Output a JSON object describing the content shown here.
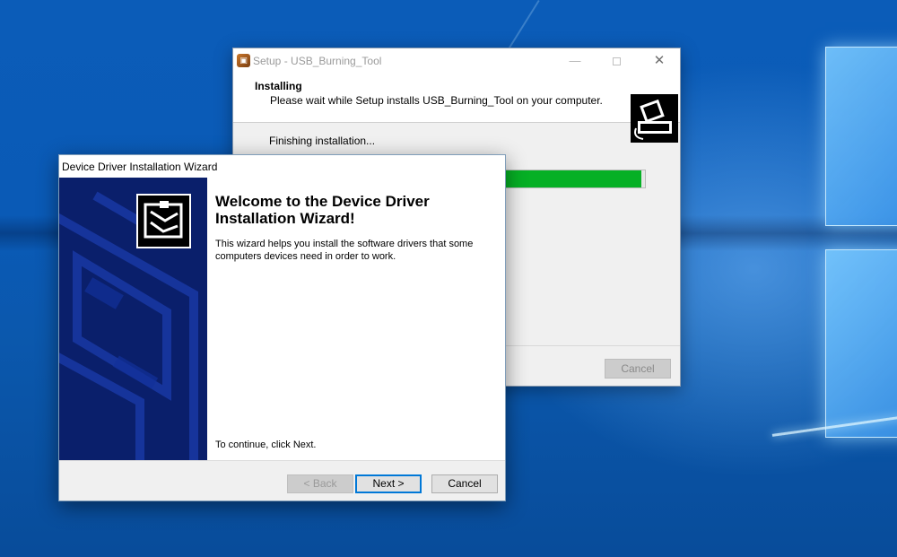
{
  "setup_window": {
    "title": "Setup - USB_Burning_Tool",
    "heading": "Installing",
    "subheading": "Please wait while Setup installs USB_Burning_Tool on your computer.",
    "status_text": "Finishing installation...",
    "progress": 0.99,
    "cancel_label": "Cancel",
    "controls": {
      "minimize": "—",
      "close": "✕"
    }
  },
  "wizard_window": {
    "title": "Device Driver Installation Wizard",
    "heading": "Welcome to the Device Driver Installation Wizard!",
    "description": "This wizard helps you install the software drivers that some computers devices need in order to work.",
    "continue_text": "To continue, click Next.",
    "buttons": {
      "back": "< Back",
      "next": "Next >",
      "cancel": "Cancel"
    }
  },
  "colors": {
    "progress_fill": "#06b025",
    "wizard_sidebar": "#0a1f6b",
    "desktop": "#0b5cb8",
    "accent_focus": "#0078d7"
  },
  "icons": {
    "setup_app": "installer-box-icon",
    "setup_header": "usb-drive-icon",
    "wizard_logo": "hardware-install-icon"
  }
}
